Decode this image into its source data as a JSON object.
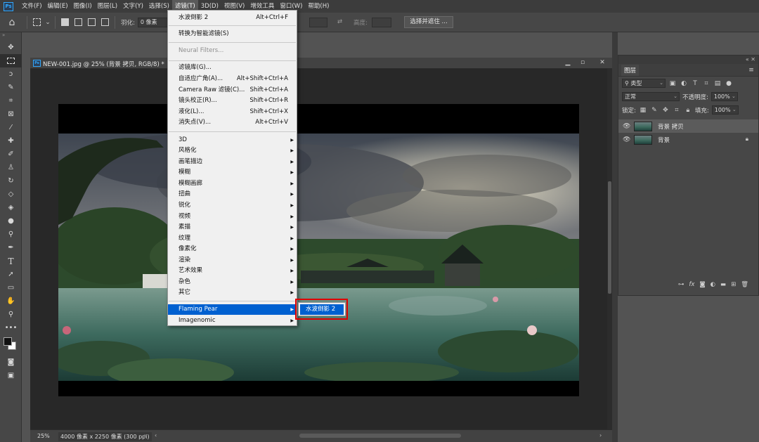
{
  "menubar": {
    "logo": "Ps",
    "items": [
      "文件(F)",
      "编辑(E)",
      "图像(I)",
      "图层(L)",
      "文字(Y)",
      "选择(S)",
      "滤镜(T)",
      "3D(D)",
      "视图(V)",
      "增效工具",
      "窗口(W)",
      "帮助(H)"
    ],
    "active_index": 6
  },
  "options_bar": {
    "feather_label": "羽化:",
    "feather_value": "0 像素",
    "height_label": "高度:",
    "select_mask_button": "选择并遮住 ..."
  },
  "document": {
    "tab_title": "NEW-001.jpg @ 25% (背景 拷贝, RGB/8) *",
    "tab_icon": "Ps",
    "zoom": "25%",
    "info": "4000 像素 x 2250 像素 (300 ppi)"
  },
  "filter_menu": {
    "items": [
      {
        "label": "水波倒影 2",
        "shortcut": "Alt+Ctrl+F"
      },
      {
        "label": "转换为智能滤镜(S)"
      },
      {
        "label": "Neural Filters...",
        "disabled": true
      },
      {
        "label": "滤镜库(G)..."
      },
      {
        "label": "自适应广角(A)...",
        "shortcut": "Alt+Shift+Ctrl+A"
      },
      {
        "label": "Camera Raw 滤镜(C)...",
        "shortcut": "Shift+Ctrl+A"
      },
      {
        "label": "镜头校正(R)...",
        "shortcut": "Shift+Ctrl+R"
      },
      {
        "label": "液化(L)...",
        "shortcut": "Shift+Ctrl+X"
      },
      {
        "label": "消失点(V)...",
        "shortcut": "Alt+Ctrl+V"
      },
      {
        "label": "3D",
        "submenu": true
      },
      {
        "label": "风格化",
        "submenu": true
      },
      {
        "label": "画笔描边",
        "submenu": true
      },
      {
        "label": "模糊",
        "submenu": true
      },
      {
        "label": "模糊画廊",
        "submenu": true
      },
      {
        "label": "扭曲",
        "submenu": true
      },
      {
        "label": "锐化",
        "submenu": true
      },
      {
        "label": "视频",
        "submenu": true
      },
      {
        "label": "素描",
        "submenu": true
      },
      {
        "label": "纹理",
        "submenu": true
      },
      {
        "label": "像素化",
        "submenu": true
      },
      {
        "label": "渲染",
        "submenu": true
      },
      {
        "label": "艺术效果",
        "submenu": true
      },
      {
        "label": "杂色",
        "submenu": true
      },
      {
        "label": "其它",
        "submenu": true
      },
      {
        "label": "Flaming Pear",
        "submenu": true,
        "highlight": true
      },
      {
        "label": "Imagenomic",
        "submenu": true
      }
    ],
    "submenu_item": "水波倒影 2",
    "highlight_color": "#0060d0",
    "callout_color": "#e00000"
  },
  "layers_panel": {
    "tab": "图层",
    "filter_kind": "类型",
    "blend_mode": "正常",
    "opacity_label": "不透明度:",
    "opacity_value": "100%",
    "lock_label": "锁定:",
    "fill_label": "填充:",
    "fill_value": "100%",
    "layers": [
      {
        "name": "背景 拷贝",
        "selected": true
      },
      {
        "name": "背景",
        "locked": true
      }
    ]
  },
  "tools": [
    "move-tool",
    "marquee-tool",
    "lasso-tool",
    "quick-select-tool",
    "crop-tool",
    "frame-tool",
    "eyedropper-tool",
    "healing-tool",
    "brush-tool",
    "stamp-tool",
    "history-brush-tool",
    "eraser-tool",
    "gradient-tool",
    "blur-tool",
    "dodge-tool",
    "pen-tool",
    "type-tool",
    "path-select-tool",
    "shape-tool",
    "hand-tool",
    "zoom-tool"
  ]
}
